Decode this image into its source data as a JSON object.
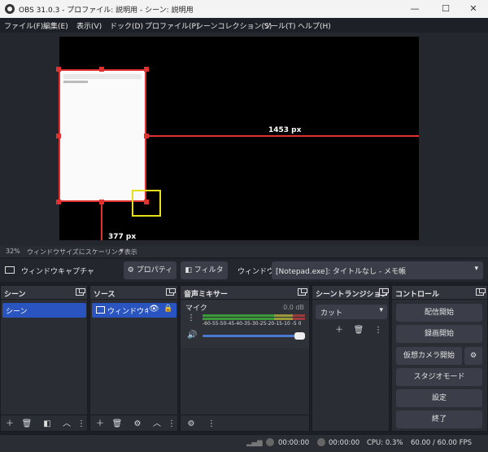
{
  "titlebar": {
    "title": "OBS 31.0.3 - プロファイル: 説明用 - シーン: 説明用",
    "minimize": "—",
    "maximize": "☐",
    "close": "✕"
  },
  "menu": [
    "ファイル(F)",
    "編集(E)",
    "表示(V)",
    "ドック(D)",
    "プロファイル(P)",
    "シーンコレクション(S)",
    "ツール(T)",
    "ヘルプ(H)"
  ],
  "preview": {
    "width_label": "1453 px",
    "height_label": "377 px"
  },
  "status_strip": {
    "zoom": "32%",
    "scaling": "ウィンドウサイズにスケーリング表示"
  },
  "source_bar": {
    "source_name": "ウィンドウキャプチャ",
    "properties": "プロパティ",
    "filters": "フィルタ",
    "window_label": "ウィンドウ",
    "window_value": "[Notepad.exe]: タイトルなし - メモ帳"
  },
  "docks": {
    "scenes": {
      "title": "シーン",
      "items": [
        "シーン"
      ]
    },
    "sources": {
      "title": "ソース",
      "items": [
        "ウィンドウキャ"
      ]
    },
    "mixer": {
      "title": "音声ミキサー",
      "channel": "マイク",
      "db": "0.0 dB",
      "scale": "-60-55-50-45-40-35-30-25-20-15-10 -5 0"
    },
    "transitions": {
      "title": "シーントランジション",
      "selected": "カット"
    },
    "controls": {
      "title": "コントロール",
      "stream": "配信開始",
      "record": "録画開始",
      "virtualcam": "仮想カメラ開始",
      "studio": "スタジオモード",
      "settings": "設定",
      "exit": "終了"
    }
  },
  "statusbar": {
    "stream_time": "00:00:00",
    "rec_time": "00:00:00",
    "cpu": "CPU: 0.3%",
    "fps": "60.00 / 60.00 FPS"
  },
  "colors": {
    "accent": "#2a55c0",
    "selection_red": "#e03030",
    "crop_yellow": "#e6e018"
  }
}
